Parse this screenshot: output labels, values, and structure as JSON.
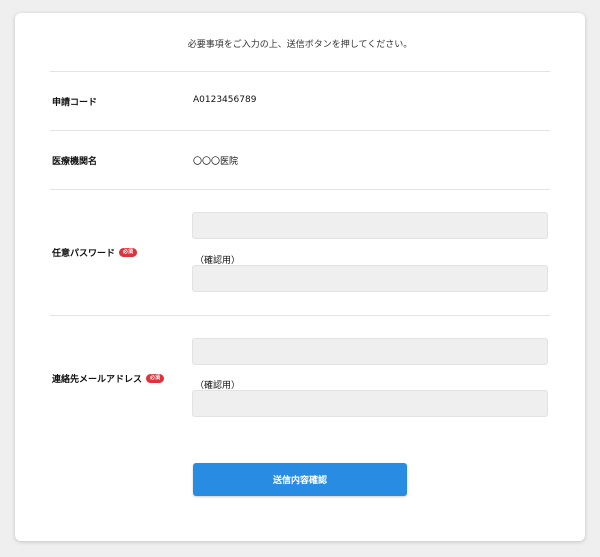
{
  "form": {
    "intro": "必要事項をご入力の上、送信ボタンを押してください。",
    "required_badge": "必須",
    "confirm_label": "（確認用）",
    "rows": {
      "application_code": {
        "label": "申請コード",
        "value": "A0123456789"
      },
      "institution": {
        "label": "医療機関名",
        "value": "〇〇〇医院"
      },
      "password": {
        "label": "任意パスワード",
        "value": "",
        "confirm_value": ""
      },
      "email": {
        "label": "連絡先メールアドレス",
        "value": "",
        "confirm_value": ""
      }
    },
    "submit_label": "送信内容確認"
  },
  "colors": {
    "background": "#efefef",
    "card": "#ffffff",
    "required_badge": "#e0323d",
    "submit_button": "#288ce3",
    "input_fill": "#efefef"
  }
}
